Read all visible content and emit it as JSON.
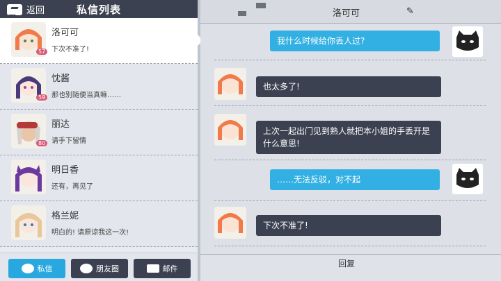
{
  "header": {
    "back_label": "返回",
    "title": "私信列表"
  },
  "contacts": [
    {
      "name": "洛可可",
      "msg": "下次不准了!",
      "level": "57"
    },
    {
      "name": "忱酱",
      "msg": "那也别随便当真嘛……",
      "level": "59"
    },
    {
      "name": "丽达",
      "msg": "请手下留情",
      "level": "80"
    },
    {
      "name": "明日香",
      "msg": "还有，再见了",
      "level": ""
    },
    {
      "name": "格兰妮",
      "msg": "明白的! 请原谅我这一次!",
      "level": ""
    }
  ],
  "tabs": [
    {
      "label": "私信"
    },
    {
      "label": "朋友圈"
    },
    {
      "label": "邮件"
    }
  ],
  "chat": {
    "title": "洛可可",
    "messages": [
      {
        "from": "me",
        "text": "我什么时候给你丢人过?"
      },
      {
        "from": "them",
        "text": "也太多了!"
      },
      {
        "from": "them",
        "text": "上次一起出门见到熟人就把本小姐的手丢开是什么意思!"
      },
      {
        "from": "me",
        "text": "……无法反驳，对不起"
      },
      {
        "from": "them",
        "text": "下次不准了!"
      }
    ],
    "reply_label": "回复"
  },
  "colors": {
    "accent": "#33b0e3",
    "dark": "#3b4150",
    "level_badge": "#d65a7a"
  }
}
